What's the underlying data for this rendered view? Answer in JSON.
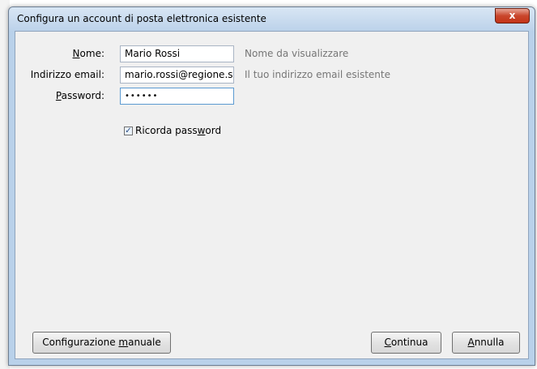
{
  "window": {
    "title": "Configura un account di posta elettronica esistente",
    "close_label": "x"
  },
  "form": {
    "name": {
      "label_pre": "",
      "label_key": "N",
      "label_post": "ome:",
      "value": "Mario Rossi",
      "hint": "Nome da visualizzare"
    },
    "email": {
      "label": "Indirizzo email:",
      "value": "mario.rossi@regione.s",
      "hint": "Il tuo indirizzo email esistente"
    },
    "password": {
      "label_pre": "",
      "label_key": "P",
      "label_post": "assword:",
      "value": "••••••"
    },
    "remember": {
      "checked": true,
      "label_pre": "Ricorda pass",
      "label_key": "w",
      "label_post": "ord"
    }
  },
  "buttons": {
    "manual": {
      "pre": "Configurazione ",
      "key": "m",
      "post": "anuale"
    },
    "continue": {
      "pre": "",
      "key": "C",
      "post": "ontinua"
    },
    "cancel": {
      "pre": "",
      "key": "A",
      "post": "nnulla"
    }
  },
  "colors": {
    "title_bar": "#bcd2ea",
    "close_button": "#c43418",
    "client_bg": "#f0f0f0",
    "hint_text": "#767676"
  }
}
